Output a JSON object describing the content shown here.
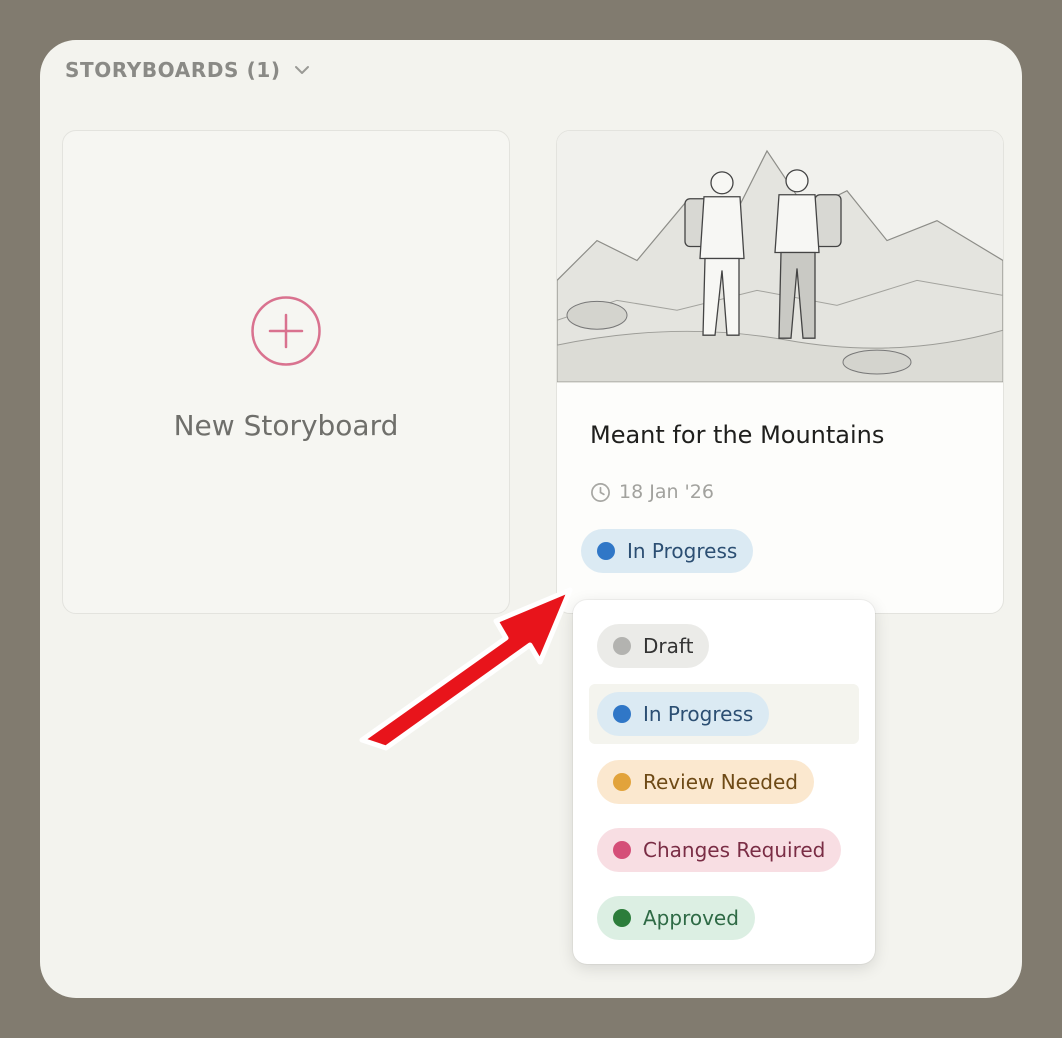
{
  "section": {
    "title": "STORYBOARDS (1)",
    "chevron_icon": "chevron-down-icon"
  },
  "new_storyboard": {
    "label": "New Storyboard",
    "icon": "plus-circle-icon",
    "accent_color": "#d9728f"
  },
  "storyboard": {
    "title": "Meant for the Mountains",
    "date": "18 Jan '26",
    "date_icon": "clock-icon",
    "status": "In Progress",
    "thumbnail": "pencil sketch of two hikers with backpacks in front of mountains"
  },
  "status_menu": {
    "selected": "In Progress",
    "options": [
      {
        "label": "Draft",
        "color": "#b3b3b0"
      },
      {
        "label": "In Progress",
        "color": "#3077c7"
      },
      {
        "label": "Review Needed",
        "color": "#e2a33b"
      },
      {
        "label": "Changes Required",
        "color": "#d54f78"
      },
      {
        "label": "Approved",
        "color": "#2c7d3b"
      }
    ]
  },
  "annotation": {
    "arrow_color": "#e8141b"
  }
}
